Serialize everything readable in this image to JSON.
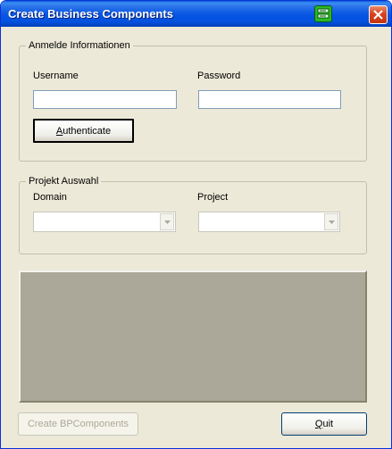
{
  "window": {
    "title": "Create Business Components",
    "icon": "green-app-icon",
    "close_icon": "close-icon"
  },
  "login": {
    "legend": "Anmelde Informationen",
    "username_label": "Username",
    "username_value": "",
    "password_label": "Password",
    "password_value": "",
    "authenticate_prefix": "",
    "authenticate_accel": "A",
    "authenticate_rest": "uthenticate"
  },
  "project": {
    "legend": "Projekt Auswahl",
    "domain_label": "Domain",
    "domain_value": "",
    "project_label": "Project",
    "project_value": ""
  },
  "footer": {
    "create_label": "Create BPComponents",
    "create_enabled": false,
    "quit_accel": "Q",
    "quit_rest": "uit"
  },
  "colors": {
    "titlebar": "#0554e3",
    "face": "#ece9d8",
    "panel": "#aca899",
    "close": "#d8431f"
  }
}
